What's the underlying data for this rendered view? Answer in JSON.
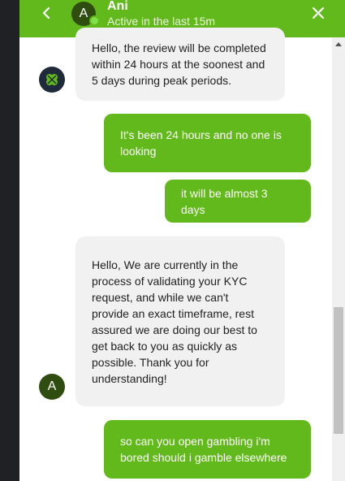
{
  "header": {
    "avatar_letter": "A",
    "agent_name": "Ani",
    "status": "Active in the last 15m"
  },
  "messages": [
    {
      "direction": "in",
      "lines": [
        "Hello, the review will be completed",
        "within 24 hours at the soonest and",
        "5 days during peak periods."
      ]
    },
    {
      "direction": "out",
      "lines": [
        "It's been 24 hours and no one is",
        "looking"
      ]
    },
    {
      "direction": "out",
      "lines": [
        "it will be almost 3 days"
      ]
    },
    {
      "direction": "in",
      "lines": [
        "Hello, We are currently in the",
        "process of validating your KYC",
        "request, and while we can't",
        "provide an exact timeframe, rest",
        "assured we are doing our best to",
        "get back to you as quickly as",
        "possible. Thank you for",
        "understanding!"
      ],
      "avatar_letter": "A"
    },
    {
      "direction": "out",
      "lines": [
        "so can you open gambling i'm",
        "bored should i gamble elsewhere"
      ]
    }
  ],
  "icons": {
    "back": "chevron-left-icon",
    "close": "close-icon",
    "brand_avatar": "clover-logo-icon",
    "scroll_up": "arrow-up-icon"
  },
  "colors": {
    "accent": "#62b91b",
    "avatar": "#2f4d0f",
    "incoming_bubble": "#f1f1f1",
    "backdrop": "#1f2125"
  }
}
